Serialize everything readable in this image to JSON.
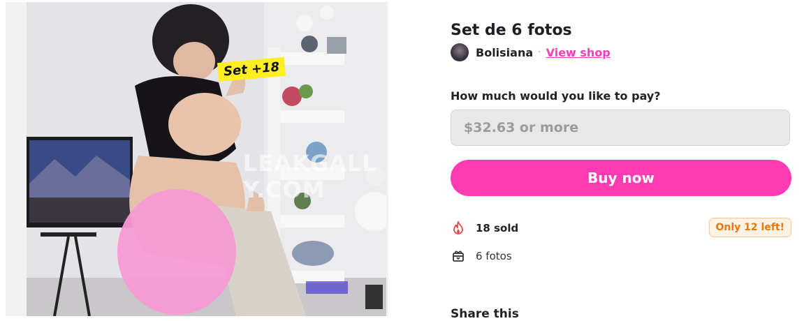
{
  "product": {
    "title": "Set de 6 fotos",
    "badge": "Set +18",
    "watermark": "LEAKGALL   Y.COM"
  },
  "seller": {
    "name": "Bolisiana",
    "separator": "·",
    "view_shop": "View shop"
  },
  "purchase": {
    "pay_label": "How much would you like to pay?",
    "price_placeholder": "$32.63 or more",
    "buy_label": "Buy now"
  },
  "stats": {
    "sold": "18 sold",
    "only_left": "Only 12 left!",
    "photos": "6 fotos"
  },
  "share": {
    "label": "Share this"
  },
  "colors": {
    "accent": "#ff3bb3",
    "link": "#ff3cb8",
    "warning_text": "#e8770f",
    "warning_bg": "#fff1e3",
    "input_bg": "#e8e8e8"
  },
  "icons": {
    "sold": "flame-icon",
    "photos": "gift-box-icon"
  }
}
